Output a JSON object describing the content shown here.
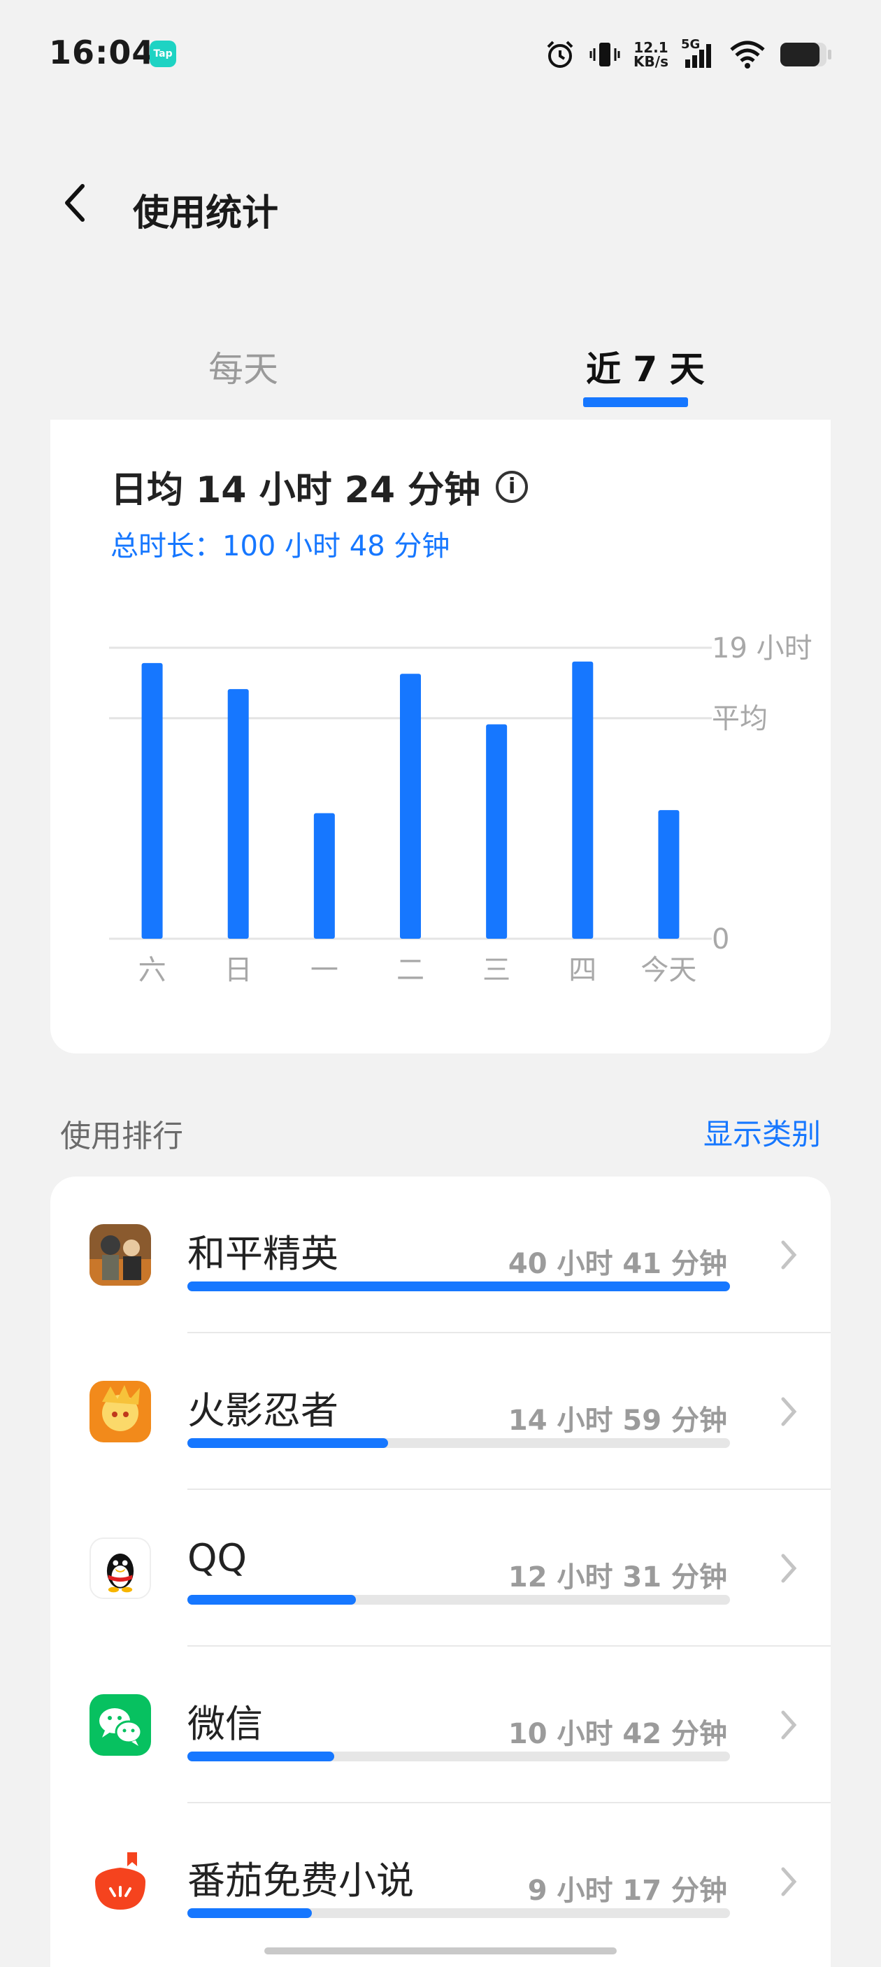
{
  "status_bar": {
    "time": "16:04",
    "tap_badge": "Tap",
    "net_speed_value": "12.1",
    "net_speed_unit": "KB/s",
    "network": "5G",
    "icons": [
      "alarm-icon",
      "vibrate-icon",
      "signal-icon",
      "wifi-icon",
      "battery-icon"
    ],
    "battery_level": 0.85
  },
  "header": {
    "title": "使用统计",
    "back_icon": "chevron-left-icon"
  },
  "tabs": [
    {
      "label": "每天",
      "selected": false
    },
    {
      "label": "近 7 天",
      "selected": true
    }
  ],
  "summary": {
    "daily_average": "日均 14 小时 24 分钟",
    "total": "总时长：100 小时 48 分钟",
    "info_icon": "info-icon"
  },
  "chart_data": {
    "type": "bar",
    "categories": [
      "六",
      "日",
      "一",
      "二",
      "三",
      "四",
      "今天"
    ],
    "values": [
      18.0,
      16.3,
      8.2,
      17.3,
      14.0,
      18.1,
      8.4
    ],
    "ylim": [
      0,
      19
    ],
    "y_tick_labels": [
      {
        "value": 19,
        "label": "19 小时"
      },
      {
        "value": 14.4,
        "label": "平均"
      },
      {
        "value": 0,
        "label": "0"
      }
    ],
    "color": "#1677ff",
    "grid": true
  },
  "ranking": {
    "title": "使用排行",
    "show_category": "显示类别",
    "apps": [
      {
        "name": "和平精英",
        "time": "40 小时 41 分钟",
        "fraction": 1.0,
        "icon": "peace-elite-icon"
      },
      {
        "name": "火影忍者",
        "time": "14 小时 59 分钟",
        "fraction": 0.37,
        "icon": "naruto-icon"
      },
      {
        "name": "QQ",
        "time": "12 小时 31 分钟",
        "fraction": 0.31,
        "icon": "qq-icon"
      },
      {
        "name": "微信",
        "time": "10 小时 42 分钟",
        "fraction": 0.27,
        "icon": "wechat-icon"
      },
      {
        "name": "番茄免费小说",
        "time": "9 小时 17 分钟",
        "fraction": 0.23,
        "icon": "tomato-novel-icon"
      }
    ]
  },
  "colors": {
    "accent": "#1677ff",
    "background": "#f2f2f2",
    "card": "#ffffff"
  }
}
